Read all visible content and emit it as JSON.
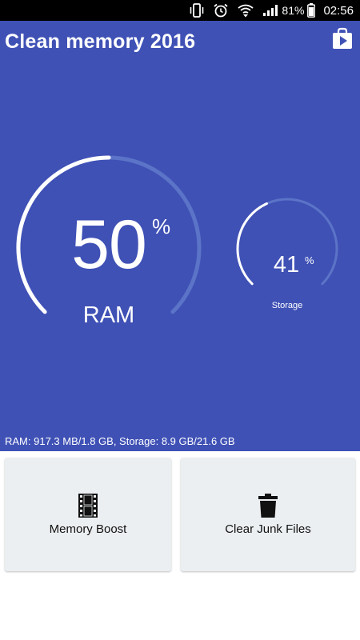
{
  "status_bar": {
    "battery_text": "81%",
    "time": "02:56",
    "icons": [
      "vibrate-icon",
      "alarm-icon",
      "wifi-icon",
      "signal-icon",
      "battery-icon"
    ]
  },
  "app": {
    "title": "Clean memory 2016",
    "store_icon": "play-store-bag-icon",
    "background_color": "#3f51b5"
  },
  "ram_gauge": {
    "value": "50",
    "unit": "%",
    "label": "RAM",
    "fraction": 0.5
  },
  "storage_gauge": {
    "value": "41",
    "unit": "%",
    "label": "Storage",
    "fraction": 0.41
  },
  "summary": "RAM: 917.3 MB/1.8 GB, Storage: 8.9 GB/21.6 GB",
  "actions": [
    {
      "label": "Memory Boost",
      "icon": "film-icon"
    },
    {
      "label": "Clear Junk Files",
      "icon": "trash-icon"
    }
  ]
}
